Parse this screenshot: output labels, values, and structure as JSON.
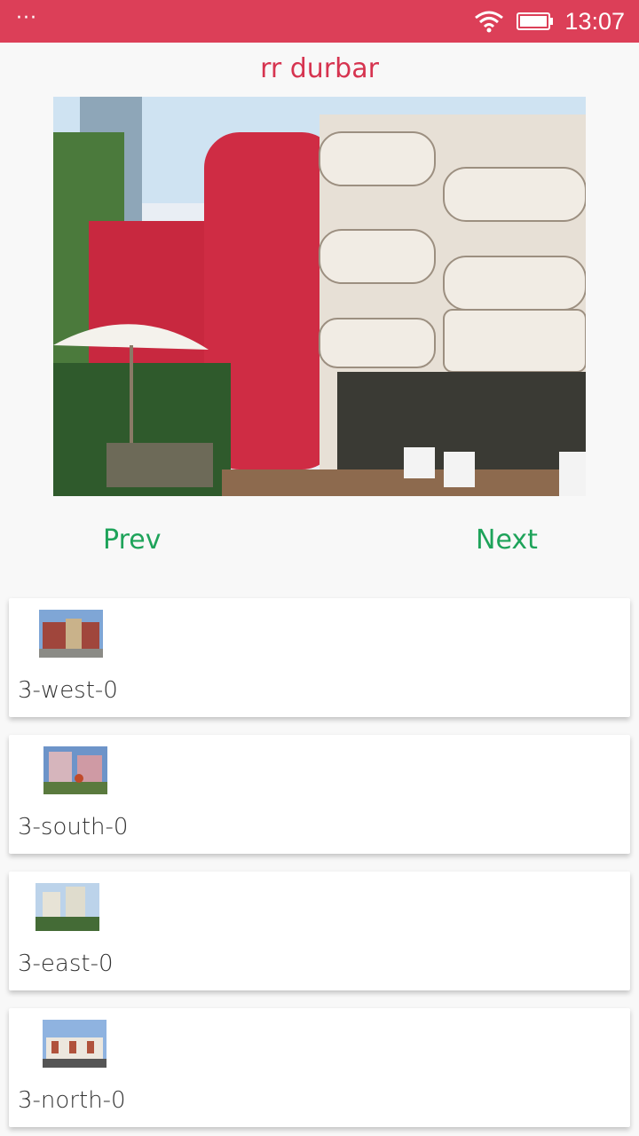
{
  "status_bar": {
    "time": "13:07",
    "menu_icon": "more-dots-icon",
    "wifi_icon": "wifi-icon",
    "battery_icon": "battery-icon"
  },
  "header": {
    "title": "rr durbar"
  },
  "hero": {
    "image": "building-photo"
  },
  "nav": {
    "prev_label": "Prev",
    "next_label": "Next"
  },
  "items": [
    {
      "label": "3-west-0",
      "thumb": "building-thumb-west"
    },
    {
      "label": "3-south-0",
      "thumb": "building-thumb-south"
    },
    {
      "label": "3-east-0",
      "thumb": "building-thumb-east"
    },
    {
      "label": "3-north-0",
      "thumb": "building-thumb-north"
    }
  ],
  "colors": {
    "status_bar": "#dc3f58",
    "title": "#d63450",
    "nav": "#1ea35a"
  }
}
